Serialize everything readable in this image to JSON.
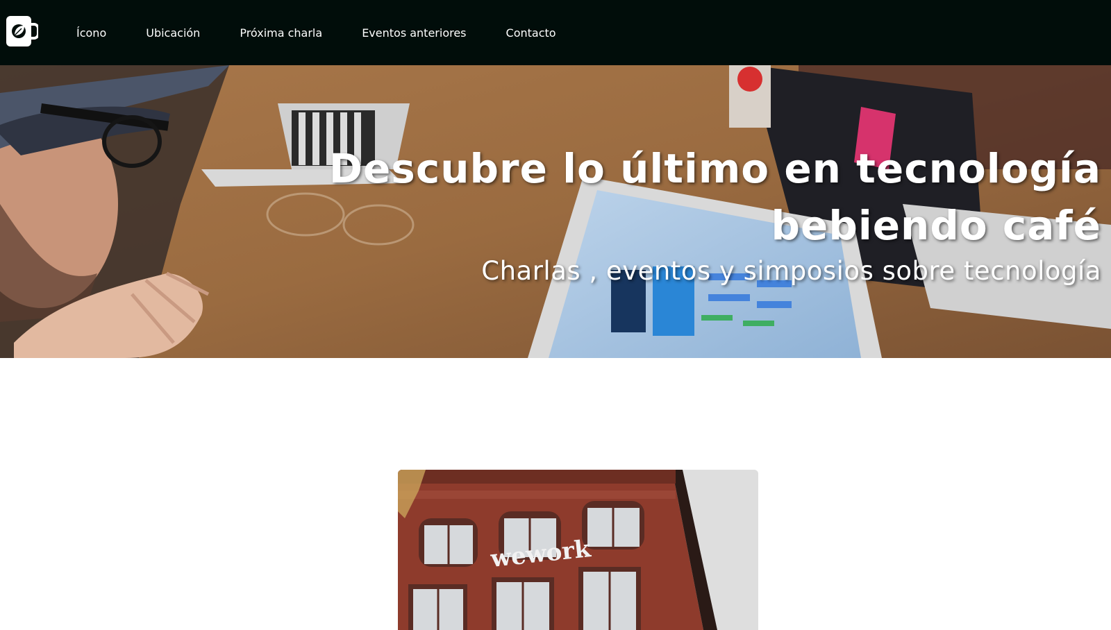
{
  "nav": {
    "logo_icon": "coffee-mug-leaf-icon",
    "links": [
      "Ícono",
      "Ubicación",
      "Próxima charla",
      "Eventos anteriores",
      "Contacto"
    ]
  },
  "hero": {
    "title_line1": "Descubre lo último en tecnología",
    "title_line2": "bebiendo café",
    "subtitle": "Charlas , eventos y simposios sobre tecnología"
  },
  "venue": {
    "sign_text": "wework"
  },
  "colors": {
    "navbar_bg": "#010d0a",
    "text_light": "#ffffff",
    "brick": "#8e3b2c"
  }
}
